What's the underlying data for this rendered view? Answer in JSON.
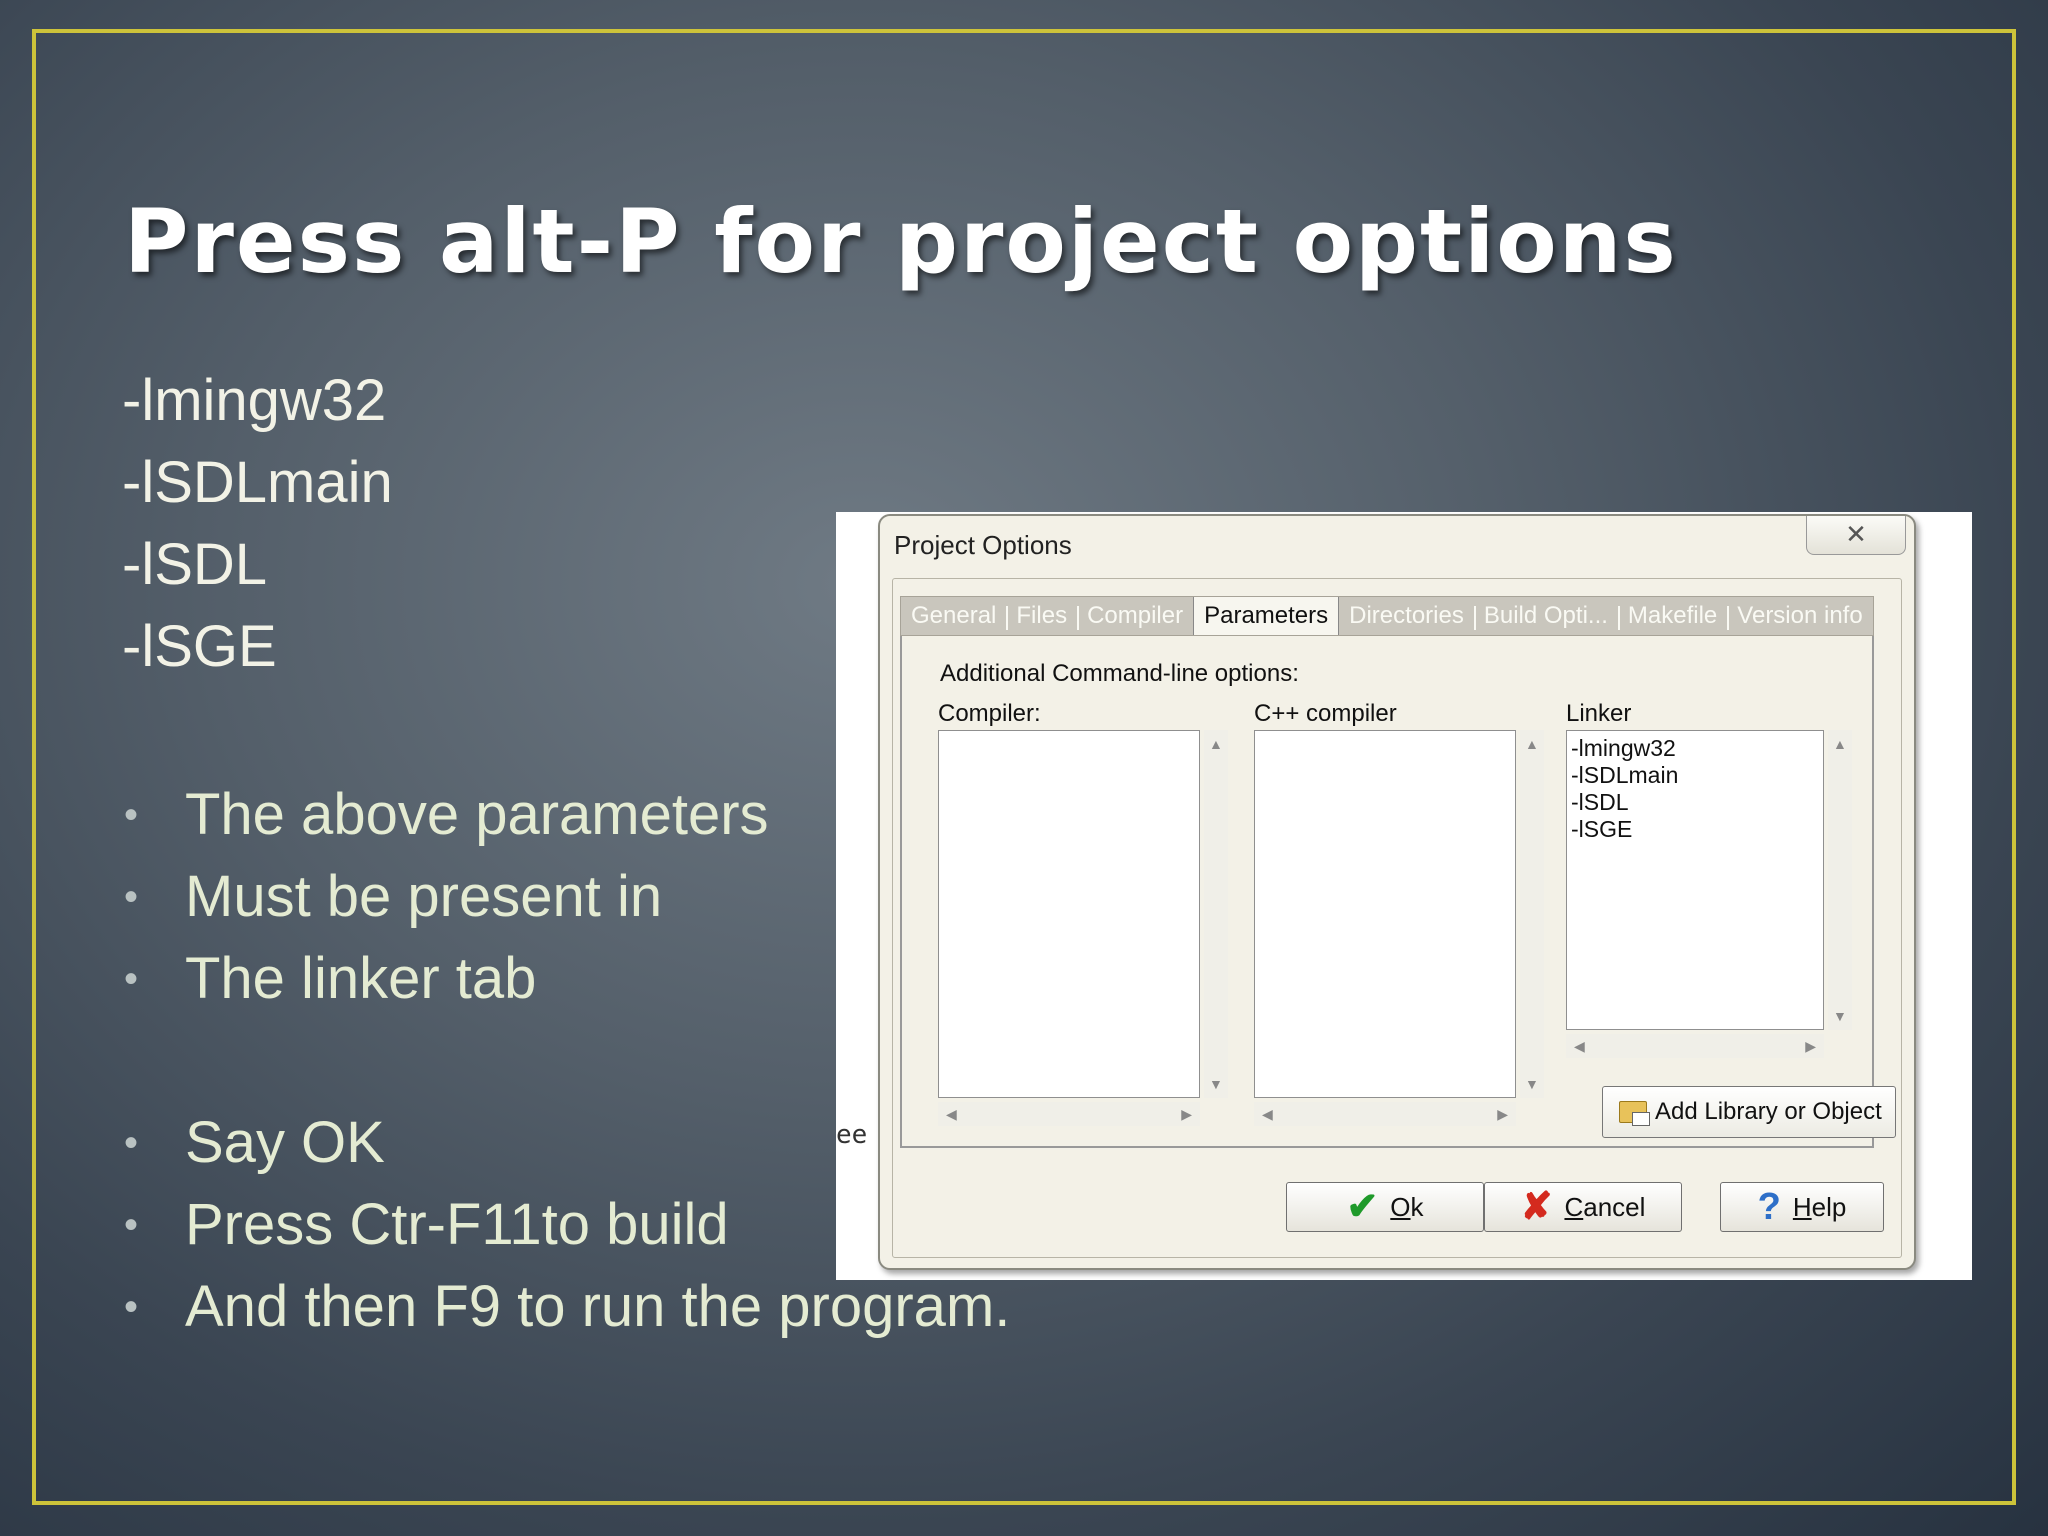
{
  "slide": {
    "title": "Press alt-P for project options",
    "params": [
      "-lmingw32",
      "-lSDLmain",
      "-lSDL",
      "-lSGE"
    ],
    "bullets_group1": [
      "The above parameters",
      "Must be present in",
      "The linker tab"
    ],
    "bullets_group2": [
      "Say OK",
      "Press Ctr-F11to build",
      "And then F9 to run the program."
    ]
  },
  "dialog": {
    "title": "Project Options",
    "close_glyph": "✕",
    "tabs": [
      {
        "label": "General",
        "active": false
      },
      {
        "label": "Files",
        "active": false
      },
      {
        "label": "Compiler",
        "active": false
      },
      {
        "label": "Parameters",
        "active": true
      },
      {
        "label": "Directories",
        "active": false
      },
      {
        "label": "Build Opti...",
        "active": false
      },
      {
        "label": "Makefile",
        "active": false
      },
      {
        "label": "Version info",
        "active": false
      }
    ],
    "additional_label": "Additional Command-line options:",
    "compiler_label": "Compiler:",
    "cpp_compiler_label": "C++ compiler",
    "linker_label": "Linker",
    "compiler_text": "",
    "cpp_compiler_text": "",
    "linker_text": "-lmingw32\n-lSDLmain\n-lSDL\n-lSGE",
    "add_library_label": "Add Library or Object",
    "ok_label": "Ok",
    "cancel_label": "Cancel",
    "help_label": "Help"
  },
  "behind_text": "ee"
}
